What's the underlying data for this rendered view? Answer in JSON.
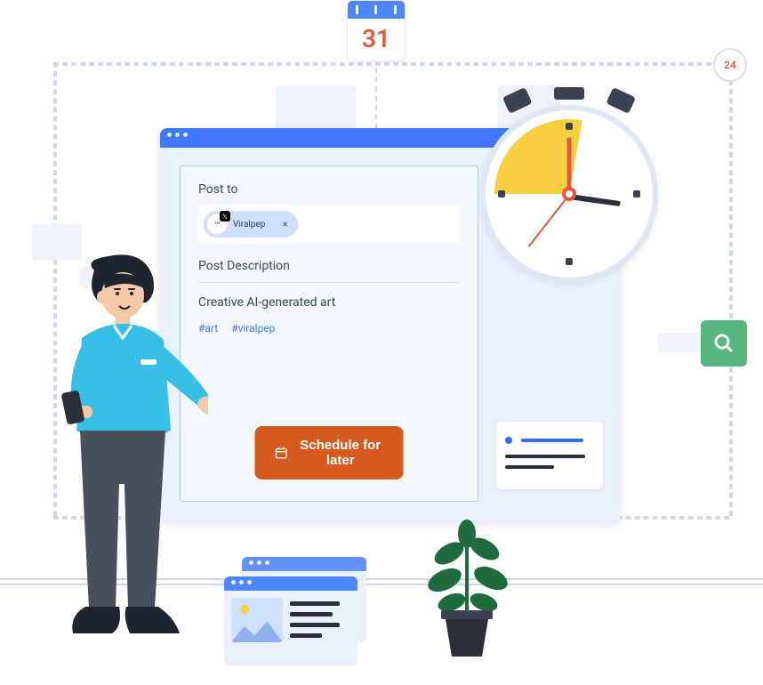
{
  "calendar": {
    "day": "31"
  },
  "badge24": {
    "label": "24"
  },
  "compose": {
    "post_to_label": "Post to",
    "account_name": "Viralpep",
    "description_label": "Post Description",
    "post_text": "Creative AI-generated art",
    "hashtags": [
      "#art",
      "#viralpep"
    ],
    "schedule_button": "Schedule for later"
  }
}
